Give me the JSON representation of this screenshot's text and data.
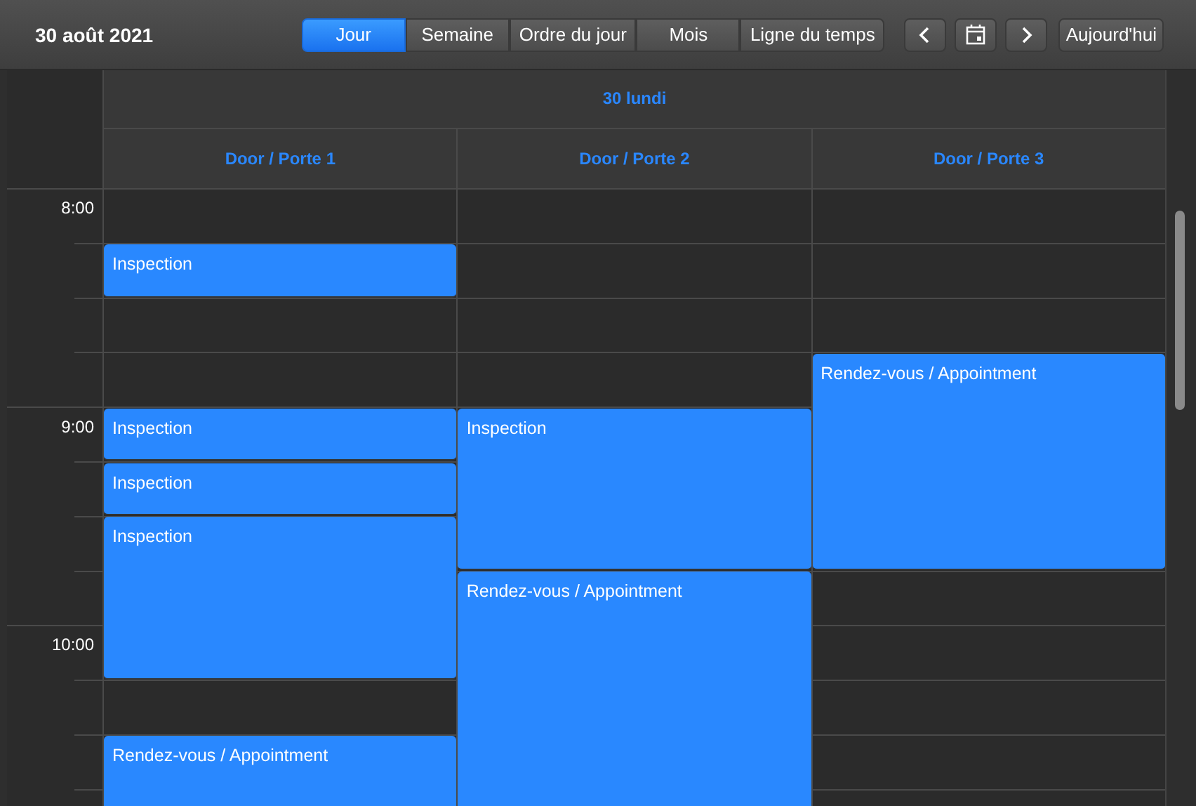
{
  "toolbar": {
    "title": "30 août 2021",
    "views": [
      {
        "label": "Jour",
        "selected": true
      },
      {
        "label": "Semaine",
        "selected": false
      },
      {
        "label": "Ordre du jour",
        "selected": false
      },
      {
        "label": "Mois",
        "selected": false
      },
      {
        "label": "Ligne du temps",
        "selected": false
      }
    ],
    "today_button": "Aujourd'hui"
  },
  "day_header": "30 lundi",
  "time_labels": [
    "8:00",
    "9:00",
    "10:00"
  ],
  "resources": [
    {
      "label": "Door / Porte 1",
      "events": [
        "Inspection",
        "Inspection",
        "Inspection",
        "Inspection",
        "Rendez-vous / Appointment"
      ]
    },
    {
      "label": "Door / Porte 2",
      "events": [
        "Inspection",
        "Rendez-vous / Appointment"
      ]
    },
    {
      "label": "Door / Porte 3",
      "events": [
        "Rendez-vous / Appointment"
      ]
    }
  ]
}
